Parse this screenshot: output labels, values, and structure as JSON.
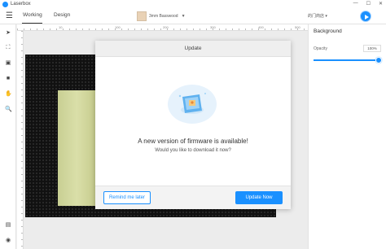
{
  "app": {
    "title": "Laserbox"
  },
  "toolbar": {
    "tabs": [
      {
        "label": "Working"
      },
      {
        "label": "Design"
      }
    ],
    "material": "3mm Basswood",
    "device": "的门商店"
  },
  "ruler": {
    "marks": [
      "10",
      "100",
      "200",
      "300",
      "400",
      "500"
    ]
  },
  "right_panel": {
    "title": "Background",
    "opacity_label": "Opacity",
    "opacity_value": "100%",
    "opacity": 1.0
  },
  "dialog": {
    "title": "Update",
    "message": "A new version of firmware is available!",
    "sub_message": "Would you like to download it now?",
    "remind_label": "Remind me later",
    "update_label": "Update Now"
  },
  "colors": {
    "accent": "#1a90ff",
    "wood": "#d4d99f",
    "camera_bg": "#111111"
  },
  "icons": [
    "app-logo",
    "minimize-icon",
    "maximize-icon",
    "close-icon",
    "menu-icon",
    "select-icon",
    "crop-icon",
    "image-icon",
    "text-icon",
    "hand-icon",
    "zoom-icon",
    "layers-icon",
    "camera-icon",
    "start-icon",
    "firmware-icon"
  ]
}
